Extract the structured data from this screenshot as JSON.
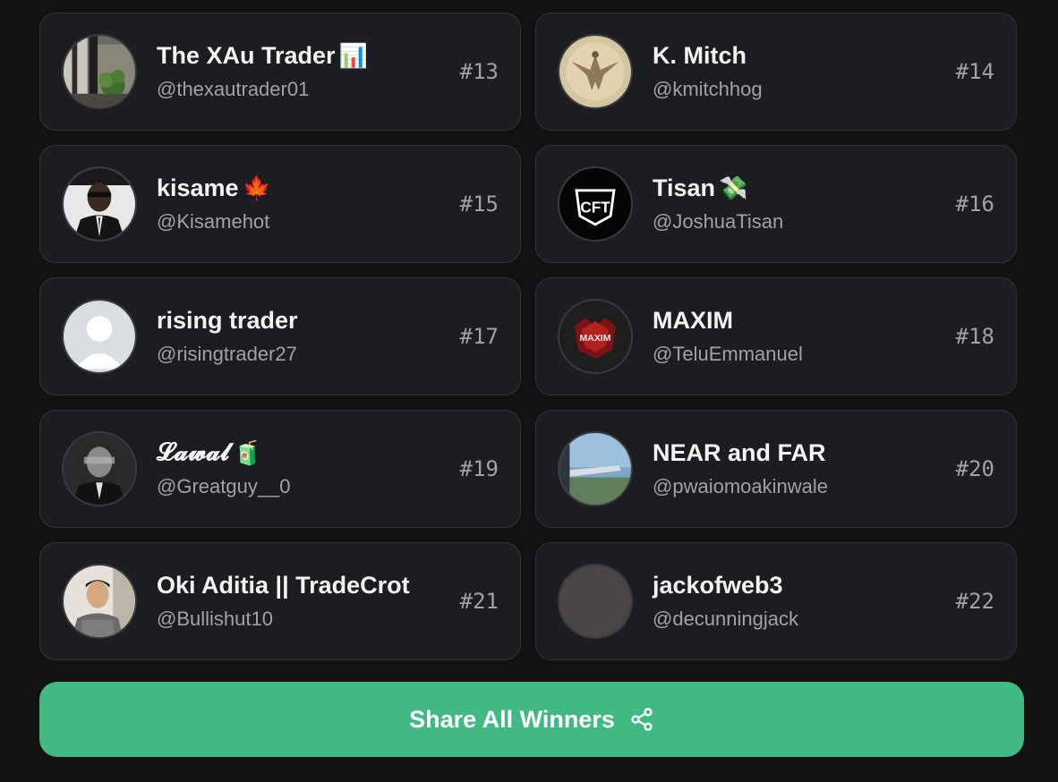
{
  "winners": [
    {
      "name": "The XAu Trader",
      "emoji": "📊",
      "handle": "@thexautrader01",
      "rank": "#13",
      "avatar_icon": "room-plant-photo"
    },
    {
      "name": "K. Mitch",
      "emoji": "",
      "handle": "@kmitchhog",
      "rank": "#14",
      "avatar_icon": "bird-engraving-photo"
    },
    {
      "name": "kisame",
      "emoji": "🍁",
      "handle": "@Kisamehot",
      "rank": "#15",
      "avatar_icon": "man-in-suit-photo"
    },
    {
      "name": "Tisan",
      "emoji": "💸",
      "handle": "@JoshuaTisan",
      "rank": "#16",
      "avatar_icon": "cft-logo"
    },
    {
      "name": "rising trader",
      "emoji": "",
      "handle": "@risingtrader27",
      "rank": "#17",
      "avatar_icon": "default-user-icon"
    },
    {
      "name": "MAXIM",
      "emoji": "",
      "handle": "@TeluEmmanuel",
      "rank": "#18",
      "avatar_icon": "maxim-logo"
    },
    {
      "name": "𝓛𝓪𝔀𝓪𝓵",
      "emoji": "🧃",
      "handle": "@Greatguy__0",
      "rank": "#19",
      "avatar_icon": "blurred-man-photo"
    },
    {
      "name": "NEAR and FAR",
      "emoji": "",
      "handle": "@pwaiomoakinwale",
      "rank": "#20",
      "avatar_icon": "airplane-window-photo"
    },
    {
      "name": "Oki Aditia || TradeCrot",
      "emoji": "",
      "handle": "@Bullishut10",
      "rank": "#21",
      "avatar_icon": "man-photo"
    },
    {
      "name": "jackofweb3",
      "emoji": "",
      "handle": "@decunningjack",
      "rank": "#22",
      "avatar_icon": "blank-avatar"
    }
  ],
  "share_button": {
    "label": "Share All Winners",
    "icon": "share-icon",
    "color": "#40b982"
  }
}
